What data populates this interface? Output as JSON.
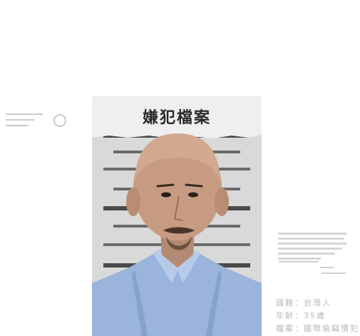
{
  "poster": {
    "title": "嫌犯檔案"
  },
  "profile": {
    "nationality": "國籍：台灣人",
    "age": "年齡：35歲",
    "file": "檔案：國際偷竊慣犯"
  },
  "colors": {
    "background": "#ffffff",
    "poster_bg": "#ededed",
    "height_bars": "#6a6a6a",
    "shirt": "#9ab4dc",
    "info_text": "#b8b8b8"
  }
}
